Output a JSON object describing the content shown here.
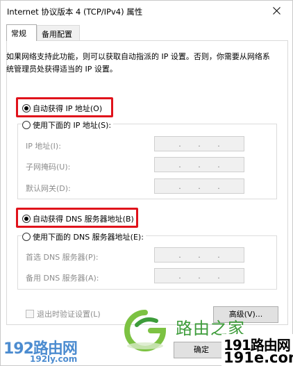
{
  "window": {
    "title": "Internet 协议版本 4 (TCP/IPv4) 属性"
  },
  "tabs": [
    {
      "label": "常规",
      "active": true
    },
    {
      "label": "备用配置",
      "active": false
    }
  ],
  "general": {
    "description": "如果网络支持此功能，则可以获取自动指派的 IP 设置。否则，你需要从网络系统管理员处获得适当的 IP 设置。",
    "ip_mode": {
      "auto_label": "自动获得 IP 地址(O)",
      "auto_checked": true,
      "manual_label": "使用下面的 IP 地址(S):",
      "manual_checked": false
    },
    "ip_fields": [
      {
        "label": "IP 地址(I):"
      },
      {
        "label": "子网掩码(U):"
      },
      {
        "label": "默认网关(D):"
      }
    ],
    "dns_mode": {
      "auto_label": "自动获得 DNS 服务器地址(B)",
      "auto_checked": true,
      "manual_label": "使用下面的 DNS 服务器地址(E):",
      "manual_checked": false
    },
    "dns_fields": [
      {
        "label": "首选 DNS 服务器(P):"
      },
      {
        "label": "备用 DNS 服务器(A):"
      }
    ],
    "validate_label": "退出时验证设置(L)",
    "validate_checked": false,
    "advanced_label": "高级(V)..."
  },
  "footer": {
    "ok_label": "确定"
  },
  "watermarks": {
    "brand": "路由之家",
    "left_main": "192路由网",
    "left_sub": "192ly.com",
    "right_line1": "191路由网",
    "right_line2": "191e.com"
  },
  "colors": {
    "highlight": "#e0121b",
    "brand_green": "#3d9c3a",
    "watermark_blue": "#2d78c8"
  }
}
